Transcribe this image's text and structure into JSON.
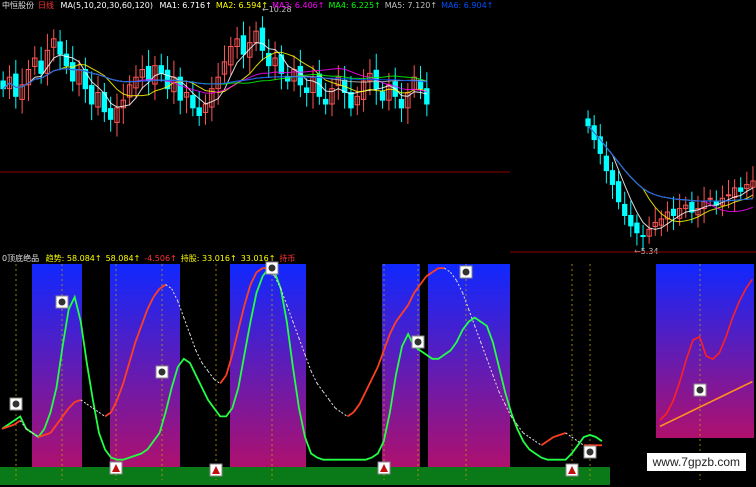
{
  "chart_data": [
    {
      "type": "candlestick",
      "stock_name": "中恒股份",
      "period": "日线",
      "ma_params": "MA(5,10,20,30,60,120)",
      "ma_readouts": [
        {
          "label": "MA1:",
          "value": "6.716",
          "color": "#ffffff"
        },
        {
          "label": "MA2:",
          "value": "6.594",
          "color": "#ffff00"
        },
        {
          "label": "MA3:",
          "value": "6.406",
          "color": "#ff00ff"
        },
        {
          "label": "MA4:",
          "value": "6.225",
          "color": "#00ff00"
        },
        {
          "label": "MA5:",
          "value": "7.120",
          "color": "#c0c0c0"
        },
        {
          "label": "MA6:",
          "value": "6.904",
          "color": "#0050ff"
        }
      ],
      "high_label": "10.28",
      "low_label": "5.34",
      "up_color": "#ff5555",
      "down_color": "#00ffff",
      "closes_left": [
        8.6,
        8.9,
        8.4,
        8.7,
        9.1,
        9.4,
        9.0,
        9.6,
        9.9,
        9.5,
        9.2,
        8.8,
        9.1,
        8.6,
        8.2,
        8.5,
        8.0,
        7.8,
        8.1,
        8.3,
        8.7,
        8.9,
        9.1,
        8.8,
        9.2,
        9.0,
        8.6,
        8.9,
        8.3,
        8.5,
        8.1,
        7.9,
        8.2,
        8.6,
        8.9,
        9.3,
        9.7,
        9.9,
        9.5,
        9.8,
        10.1,
        9.6,
        9.2,
        9.4,
        9.0,
        8.8,
        9.1,
        8.7,
        8.5,
        8.9,
        8.4,
        8.2,
        8.6,
        8.9,
        8.5,
        8.1,
        8.4,
        8.8,
        9.0,
        8.6,
        8.3,
        8.7,
        8.4,
        8.1,
        8.5,
        8.9,
        8.6,
        8.2
      ],
      "closes_right": [
        8.6,
        8.2,
        7.8,
        7.3,
        6.9,
        6.4,
        6.0,
        5.7,
        5.5,
        5.4,
        5.6,
        5.8,
        5.9,
        6.1,
        6.0,
        6.2,
        6.3,
        6.1,
        6.2,
        6.4,
        6.5,
        6.3,
        6.5,
        6.6,
        6.8,
        6.7,
        6.9,
        7.0
      ]
    },
    {
      "type": "line",
      "indicator_name": "0顶底绝品",
      "readouts": [
        {
          "label": "趋势:",
          "value": "58.084",
          "color": "#ffff00"
        },
        {
          "label": "",
          "value": "58.084",
          "color": "#ffff00"
        },
        {
          "label": "",
          "value": "-4.506",
          "color": "#ff3333"
        },
        {
          "label": "持股:",
          "value": "33.016",
          "color": "#ffff00"
        },
        {
          "label": "",
          "value": "33.016",
          "color": "#ffff00"
        },
        {
          "label": "持币",
          "value": "",
          "color": "#ff3333"
        }
      ],
      "ylim": [
        0,
        100
      ],
      "series": [
        {
          "key": "trend",
          "values": [
            20,
            22,
            24,
            26,
            20,
            18,
            16,
            20,
            28,
            40,
            60,
            78,
            84,
            72,
            52,
            34,
            18,
            10,
            6,
            5,
            5,
            6,
            7,
            8,
            10,
            14,
            18,
            28,
            40,
            50,
            54,
            52,
            46,
            40,
            34,
            30,
            26,
            26,
            30,
            40,
            56,
            72,
            86,
            94,
            98,
            96,
            88,
            72,
            50,
            30,
            16,
            8,
            6,
            5,
            5,
            5,
            5,
            5,
            5,
            5,
            5,
            6,
            8,
            14,
            28,
            46,
            60,
            66,
            60,
            58,
            56,
            54,
            54,
            56,
            58,
            62,
            68,
            72,
            74,
            72,
            70,
            62,
            50,
            38,
            28,
            20,
            14,
            10,
            8,
            6,
            5,
            5,
            5,
            5,
            8,
            12,
            16,
            17,
            16,
            14
          ]
        },
        {
          "key": "hold",
          "values": [
            20,
            21,
            22,
            24,
            20,
            18,
            16,
            17,
            18,
            22,
            26,
            30,
            33,
            34,
            32,
            30,
            28,
            26,
            28,
            34,
            42,
            52,
            62,
            70,
            78,
            84,
            88,
            90,
            88,
            82,
            74,
            66,
            58,
            52,
            48,
            44,
            42,
            46,
            56,
            68,
            80,
            90,
            96,
            98,
            98,
            94,
            88,
            80,
            72,
            64,
            56,
            48,
            42,
            38,
            34,
            30,
            28,
            26,
            28,
            32,
            38,
            44,
            50,
            58,
            66,
            72,
            76,
            80,
            86,
            90,
            94,
            96,
            98,
            98,
            96,
            92,
            86,
            78,
            70,
            62,
            54,
            46,
            38,
            32,
            26,
            22,
            18,
            16,
            14,
            12,
            14,
            16,
            17,
            18,
            16,
            14,
            12,
            12,
            12,
            12
          ]
        }
      ]
    }
  ],
  "watermark": "www.7gpzb.com"
}
